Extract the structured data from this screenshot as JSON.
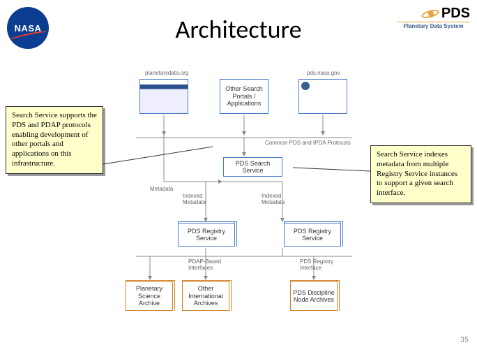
{
  "logos": {
    "nasa_text": "NASA",
    "pds_text": "PDS",
    "pds_sub": "Planetary Data System"
  },
  "title": "Architecture",
  "callout_left": "Search Service supports the PDS and PDAP protocols enabling development of other portals and applications on this infrastructure.",
  "callout_right": "Search Service indexes metadata from multiple Registry Service instances to support a given search interface.",
  "labels": {
    "url_left": "planetarydata.org",
    "url_right": "pds.nasa.gov",
    "protocols": "Common PDS and IPDA Protocols",
    "metadata": "Metadata",
    "indexed_l": "Indexed\nMetadata",
    "indexed_r": "Indexed\nMetadata",
    "pdap_if": "PDAP-Based\nInterfaces",
    "pds_if": "PDS Registry\nInterface"
  },
  "boxes": {
    "other_portals": "Other Search Portals / Applications",
    "search_service": "PDS Search Service",
    "reg_l": "PDS Registry Service",
    "reg_r": "PDS Registry Service",
    "planetary": "Planetary Science Archive",
    "other_intl": "Other International Archives",
    "discipline": "PDS Discipline Node Archives"
  },
  "page_number": "35"
}
